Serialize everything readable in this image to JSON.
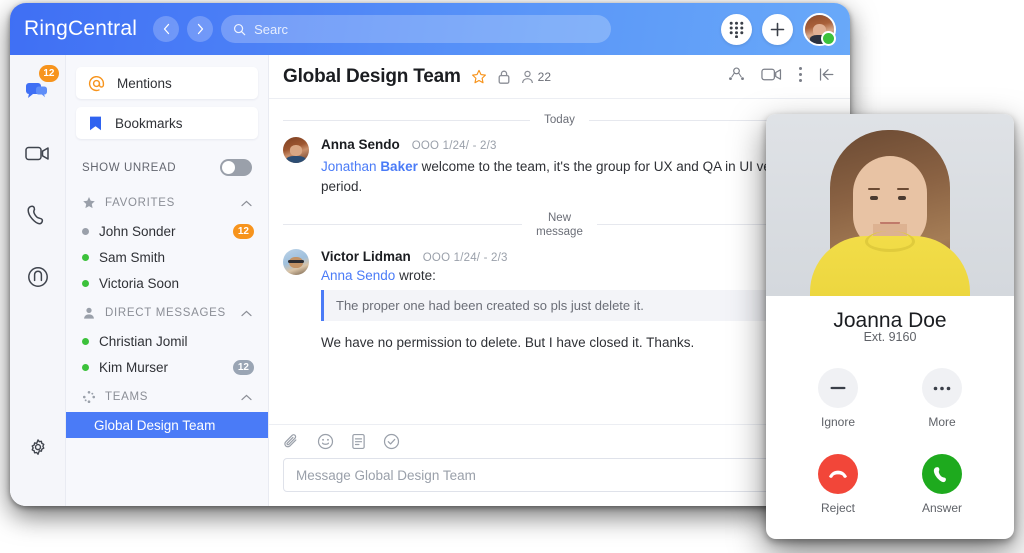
{
  "topbar": {
    "brand": "RingCentral",
    "back_icon": "chevron-left-icon",
    "forward_icon": "chevron-right-icon",
    "search_placeholder": "Searc",
    "search_icon": "search-icon",
    "dialpad_icon": "dialpad-icon",
    "add_icon": "plus-icon",
    "avatar": "user-avatar",
    "presence": "online",
    "gradient_from": "#3f6ff4",
    "gradient_to": "#69a9f9"
  },
  "rail": {
    "items": [
      {
        "name": "message",
        "icon": "message-bubbles-icon",
        "badge": "12",
        "active": true
      },
      {
        "name": "video",
        "icon": "video-camera-icon",
        "badge": "",
        "active": false
      },
      {
        "name": "phone",
        "icon": "phone-handset-icon",
        "badge": "",
        "active": false
      },
      {
        "name": "contacts",
        "icon": "contacts-icon",
        "badge": "",
        "active": false
      }
    ],
    "settings_icon": "gear-icon",
    "badge_color": "#f7941d"
  },
  "sidebar": {
    "cards": [
      {
        "label": "Mentions",
        "icon": "at-sign-icon",
        "color": "#f7941d"
      },
      {
        "label": "Bookmarks",
        "icon": "bookmark-icon",
        "color": "#2f63f0"
      }
    ],
    "show_unread_label": "SHOW UNREAD",
    "show_unread_on": false,
    "sections": [
      {
        "title": "FAVORITES",
        "icon": "star-icon",
        "chevron": "chevron-up-icon",
        "items": [
          {
            "name": "John Sonder",
            "presence": "offline",
            "count": "12",
            "count_style": "orange"
          },
          {
            "name": "Sam Smith",
            "presence": "online",
            "count": "",
            "count_style": ""
          },
          {
            "name": "Victoria Soon",
            "presence": "online",
            "count": "",
            "count_style": ""
          }
        ]
      },
      {
        "title": "DIRECT MESSAGES",
        "icon": "person-icon",
        "chevron": "chevron-up-icon",
        "items": [
          {
            "name": "Christian Jomil",
            "presence": "online",
            "count": "",
            "count_style": ""
          },
          {
            "name": "Kim Murser",
            "presence": "online",
            "count": "12",
            "count_style": "gray"
          }
        ]
      },
      {
        "title": "TEAMS",
        "icon": "teams-icon",
        "chevron": "chevron-up-icon",
        "items": [
          {
            "name": "Global Design Team",
            "presence": "",
            "count": "",
            "count_style": "",
            "selected": true
          }
        ]
      }
    ],
    "selected_color": "#4a7bf7"
  },
  "conversation": {
    "title": "Global Design Team",
    "star_icon": "star-outline-icon",
    "lock_icon": "lock-icon",
    "members_icon": "person-icon",
    "members_count": "22",
    "header_actions": [
      {
        "icon": "share-network-icon",
        "name": "share-button"
      },
      {
        "icon": "video-camera-icon",
        "name": "video-call-button"
      },
      {
        "icon": "more-vertical-icon",
        "name": "more-button"
      },
      {
        "icon": "collapse-left-icon",
        "name": "collapse-panel-button"
      }
    ],
    "dividers": {
      "today": "Today",
      "new_message": "New\nmessage"
    },
    "messages": [
      {
        "author": "Anna Sendo",
        "status": "OOO 1/24/ - 2/3",
        "avatar": "anna-avatar",
        "mention": "Jonathan ",
        "mention_bold": "Baker",
        "text": " welcome to the team, it's the group for UX and QA in UI verification period."
      },
      {
        "author": "Victor Lidman",
        "status": "OOO 1/24/ - 2/3",
        "avatar": "victor-avatar",
        "quote_author": "Anna Sendo",
        "quote_verb": " wrote:",
        "quote_text": "The proper one had been created so pls just delete it.",
        "reply_text": "We have no permission to delete. But I have closed it. Thanks."
      }
    ],
    "compose": {
      "tools": [
        {
          "icon": "paperclip-icon",
          "name": "attach-file-button"
        },
        {
          "icon": "emoji-icon",
          "name": "emoji-button"
        },
        {
          "icon": "note-icon",
          "name": "create-note-button"
        },
        {
          "icon": "task-check-icon",
          "name": "create-task-button"
        }
      ],
      "placeholder": "Message Global Design Team"
    }
  },
  "call_card": {
    "caller_name": "Joanna Doe",
    "extension": "Ext. 9160",
    "photo": "caller-photo",
    "buttons": [
      {
        "label": "Ignore",
        "icon": "minus-icon",
        "style": "gray",
        "name": "ignore-call-button"
      },
      {
        "label": "More",
        "icon": "dots-icon",
        "style": "gray",
        "name": "more-call-options-button"
      },
      {
        "label": "Reject",
        "icon": "hang-up-icon",
        "style": "red",
        "name": "reject-call-button"
      },
      {
        "label": "Answer",
        "icon": "phone-handset-icon",
        "style": "green",
        "name": "answer-call-button"
      }
    ],
    "reject_color": "#f24639",
    "answer_color": "#1eaa1e"
  }
}
